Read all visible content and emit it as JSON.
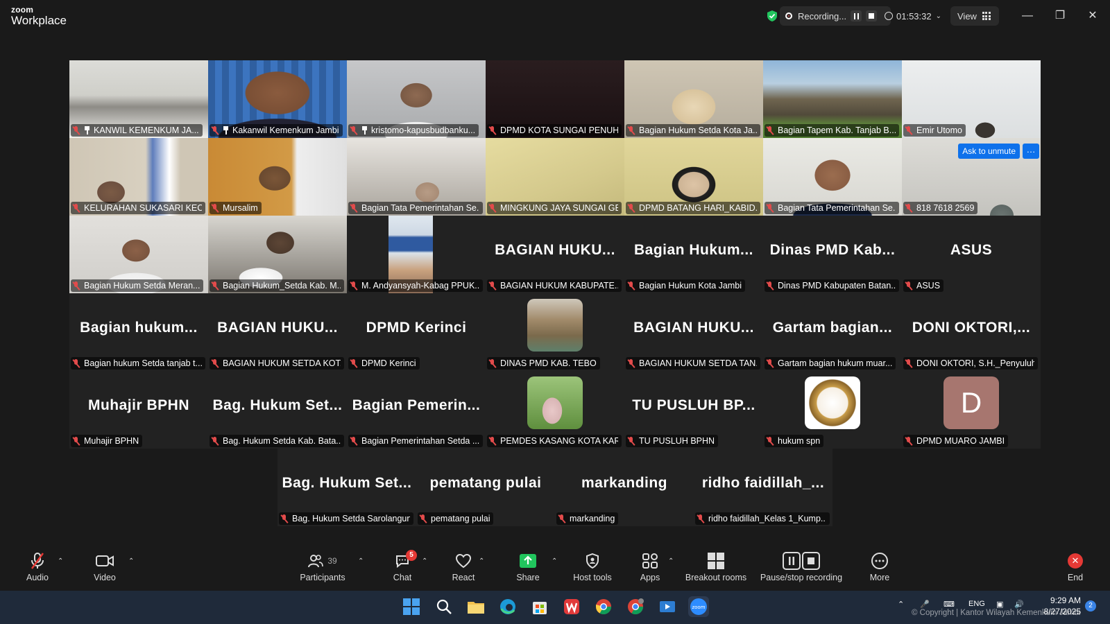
{
  "app": {
    "brand_top": "zoom",
    "brand_bottom": "Workplace"
  },
  "titlebar": {
    "recording_label": "Recording...",
    "timer": "01:53:32",
    "view_label": "View"
  },
  "tiles": [
    {
      "name": "KANWIL KEMENKUM JA...",
      "pinned": true,
      "video": "room"
    },
    {
      "name": "Kakanwil Kemenkum Jambi",
      "pinned": true,
      "video": "man-blue",
      "active": true
    },
    {
      "name": "kristomo-kapusbudbanku...",
      "pinned": true,
      "video": "man-office"
    },
    {
      "name": "DPMD KOTA SUNGAI PENUH",
      "video": "dark"
    },
    {
      "name": "Bagian Hukum Setda Kota Ja...",
      "video": "woman-hijab"
    },
    {
      "name": "Bagian Tapem Kab. Tanjab B...",
      "video": "temple"
    },
    {
      "name": "Emir Utomo",
      "video": "wall"
    },
    {
      "name": "KELURAHAN SUKASARI KEC. ...",
      "video": "window-man"
    },
    {
      "name": "Mursalim",
      "video": "man-orange"
    },
    {
      "name": "Bagian Tata Pemerintahan Se...",
      "video": "office-woman"
    },
    {
      "name": "MINGKUNG JAYA SUNGAI GE...",
      "video": "yellow-wall"
    },
    {
      "name": "DPMD BATANG HARI_KABID...",
      "video": "woman-yellow"
    },
    {
      "name": "Bagian Tata Pemerintahan Se...",
      "video": "young-man"
    },
    {
      "name": "818 7618 2569",
      "video": "grey-room",
      "ask_unmute": "Ask to unmute"
    },
    {
      "name": "Bagian Hukum Setda Meran...",
      "video": "man-white"
    },
    {
      "name": "Bagian Hukum_Setda Kab. M...",
      "video": "man-reading"
    },
    {
      "name": "M. Andyansyah-Kabag PPUK...",
      "video": "banner"
    },
    {
      "name": "BAGIAN HUKUM KABUPATE...",
      "center": "BAGIAN HUKU..."
    },
    {
      "name": "Bagian Hukum Kota Jambi",
      "center": "Bagian Hukum..."
    },
    {
      "name": "Dinas PMD Kabupaten Batan...",
      "center": "Dinas PMD Kab..."
    },
    {
      "name": "ASUS",
      "center": "ASUS"
    },
    {
      "name": "Bagian hukum Setda tanjab t...",
      "center": "Bagian hukum..."
    },
    {
      "name": "BAGIAN HUKUM SETDA KOT...",
      "center": "BAGIAN HUKU..."
    },
    {
      "name": "DPMD Kerinci",
      "center": "DPMD Kerinci"
    },
    {
      "name": "DINAS PMD KAB. TEBO",
      "avatar": "classroom"
    },
    {
      "name": "BAGIAN HUKUM SETDA TAN...",
      "center": "BAGIAN HUKU..."
    },
    {
      "name": "Gartam bagian hukum muar...",
      "center": "Gartam bagian..."
    },
    {
      "name": "DONI OKTORI, S.H._Penyuluh...",
      "center": "DONI OKTORI,..."
    },
    {
      "name": "Muhajir BPHN",
      "center": "Muhajir BPHN"
    },
    {
      "name": "Bag. Hukum Setda Kab. Bata...",
      "center": "Bag. Hukum Set..."
    },
    {
      "name": "Bagian Pemerintahan Setda ...",
      "center": "Bagian Pemerin..."
    },
    {
      "name": "PEMDES KASANG KOTA KAR...",
      "avatar": "garden"
    },
    {
      "name": "TU PUSLUH BPHN",
      "center": "TU PUSLUH BP..."
    },
    {
      "name": "hukum spn",
      "avatar": "scales"
    },
    {
      "name": "DPMD MUARO JAMBI",
      "avatar_letter": "D"
    },
    {
      "name": "Bag. Hukum Setda Sarolangun",
      "center": "Bag. Hukum Set..."
    },
    {
      "name": "pematang pulai",
      "center": "pematang pulai"
    },
    {
      "name": "markanding",
      "center": "markanding"
    },
    {
      "name": "ridho faidillah_Kelas 1_Kump...",
      "center": "ridho faidillah_..."
    }
  ],
  "toolbar": {
    "audio": "Audio",
    "video": "Video",
    "participants": "Participants",
    "participants_count": "39",
    "chat": "Chat",
    "chat_badge": "5",
    "react": "React",
    "share": "Share",
    "host_tools": "Host tools",
    "apps": "Apps",
    "breakout": "Breakout rooms",
    "pause_stop": "Pause/stop recording",
    "more": "More",
    "end": "End"
  },
  "taskbar": {
    "lang": "ENG",
    "time": "9:29 AM",
    "date": "8/27/2025",
    "notifications": "2",
    "copyright": "© Copyright | Kantor Wilayah Kemenkum Jambi"
  },
  "colors": {
    "active_speaker": "#3ccc6e",
    "ask_unmute": "#0e71eb",
    "muted_mic": "#e24b4b",
    "share": "#21c55d"
  }
}
